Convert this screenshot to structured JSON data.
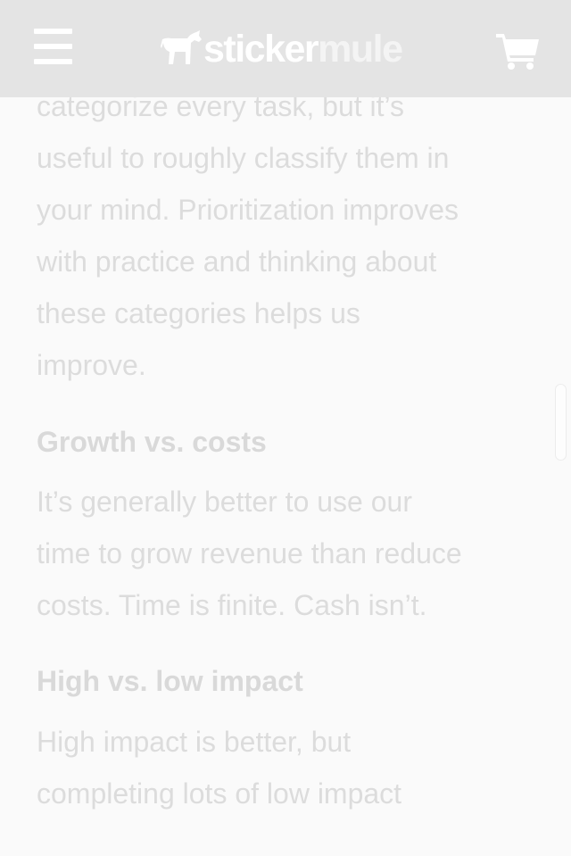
{
  "header": {
    "menu_icon": "hamburger-menu-icon",
    "logo": {
      "word_sticker": "sticker",
      "word_mule": "mule",
      "icon": "mule-logo-icon"
    },
    "cart_icon": "shopping-cart-icon"
  },
  "article": {
    "intro_lines": [
      "categorize every task, but it’s",
      "useful to roughly classify them in",
      "your mind. Prioritization improves",
      "with practice and thinking about",
      "these categories helps us",
      "improve."
    ],
    "section1": {
      "heading": "Growth vs. costs",
      "lines": [
        "It’s generally better to use our",
        "time to grow revenue than reduce",
        "costs. Time is finite. Cash isn’t."
      ]
    },
    "section2": {
      "heading": "High vs. low impact",
      "lines": [
        "High impact is better, but",
        "completing lots of low impact"
      ]
    }
  },
  "colors": {
    "header_bg": "#e4e4e4",
    "text": "#dcdcdc",
    "icons": "#ffffff"
  }
}
